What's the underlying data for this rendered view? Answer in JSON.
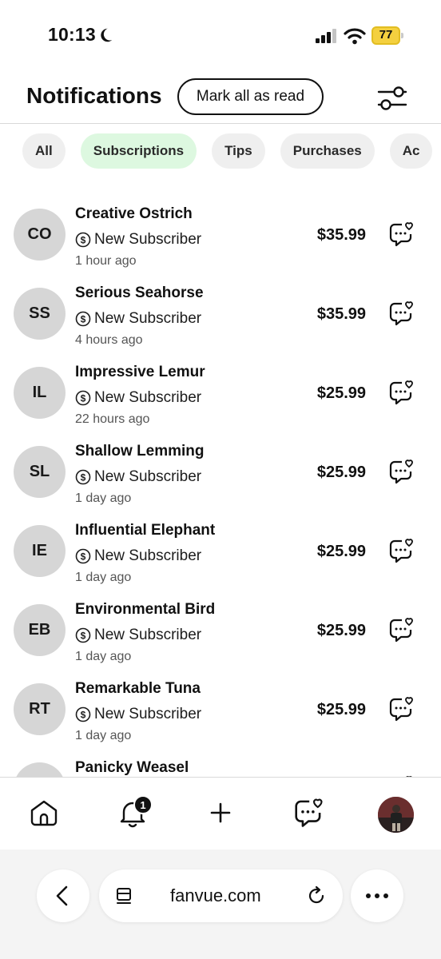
{
  "status_bar": {
    "time": "10:13",
    "battery": "77",
    "icons": [
      "moon-icon",
      "signal-icon",
      "wifi-icon",
      "battery-icon"
    ]
  },
  "header": {
    "title": "Notifications",
    "mark_all_label": "Mark all as read",
    "filter_icon": "sliders-icon"
  },
  "filters": {
    "active": "Subscriptions",
    "chips": [
      "All",
      "Subscriptions",
      "Tips",
      "Purchases",
      "Ac"
    ]
  },
  "colors": {
    "active_chip": "#ddf8e0",
    "chip": "#efefef",
    "avatar": "#d6d6d6",
    "battery": "#f4d03f"
  },
  "notifications": [
    {
      "initials": "CO",
      "name": "Creative Ostrich",
      "type": "New Subscriber",
      "time": "1 hour ago",
      "amount": "$35.99"
    },
    {
      "initials": "SS",
      "name": "Serious Seahorse",
      "type": "New Subscriber",
      "time": "4 hours ago",
      "amount": "$35.99"
    },
    {
      "initials": "IL",
      "name": "Impressive Lemur",
      "type": "New Subscriber",
      "time": "22 hours ago",
      "amount": "$25.99"
    },
    {
      "initials": "SL",
      "name": "Shallow Lemming",
      "type": "New Subscriber",
      "time": "1 day ago",
      "amount": "$25.99"
    },
    {
      "initials": "IE",
      "name": "Influential Elephant",
      "type": "New Subscriber",
      "time": "1 day ago",
      "amount": "$25.99"
    },
    {
      "initials": "EB",
      "name": "Environmental Bird",
      "type": "New Subscriber",
      "time": "1 day ago",
      "amount": "$25.99"
    },
    {
      "initials": "RT",
      "name": "Remarkable Tuna",
      "type": "New Subscriber",
      "time": "1 day ago",
      "amount": "$25.99"
    },
    {
      "initials": "",
      "name": "Panicky Weasel",
      "type": "",
      "time": "",
      "amount": ""
    }
  ],
  "bottom_nav": {
    "items": [
      "home-icon",
      "bell-icon",
      "plus-icon",
      "messages-icon",
      "profile-avatar"
    ],
    "notification_badge": "1"
  },
  "browser": {
    "url": "fanvue.com",
    "icons": [
      "back-chevron-icon",
      "reader-icon",
      "reload-icon",
      "more-icon"
    ]
  }
}
